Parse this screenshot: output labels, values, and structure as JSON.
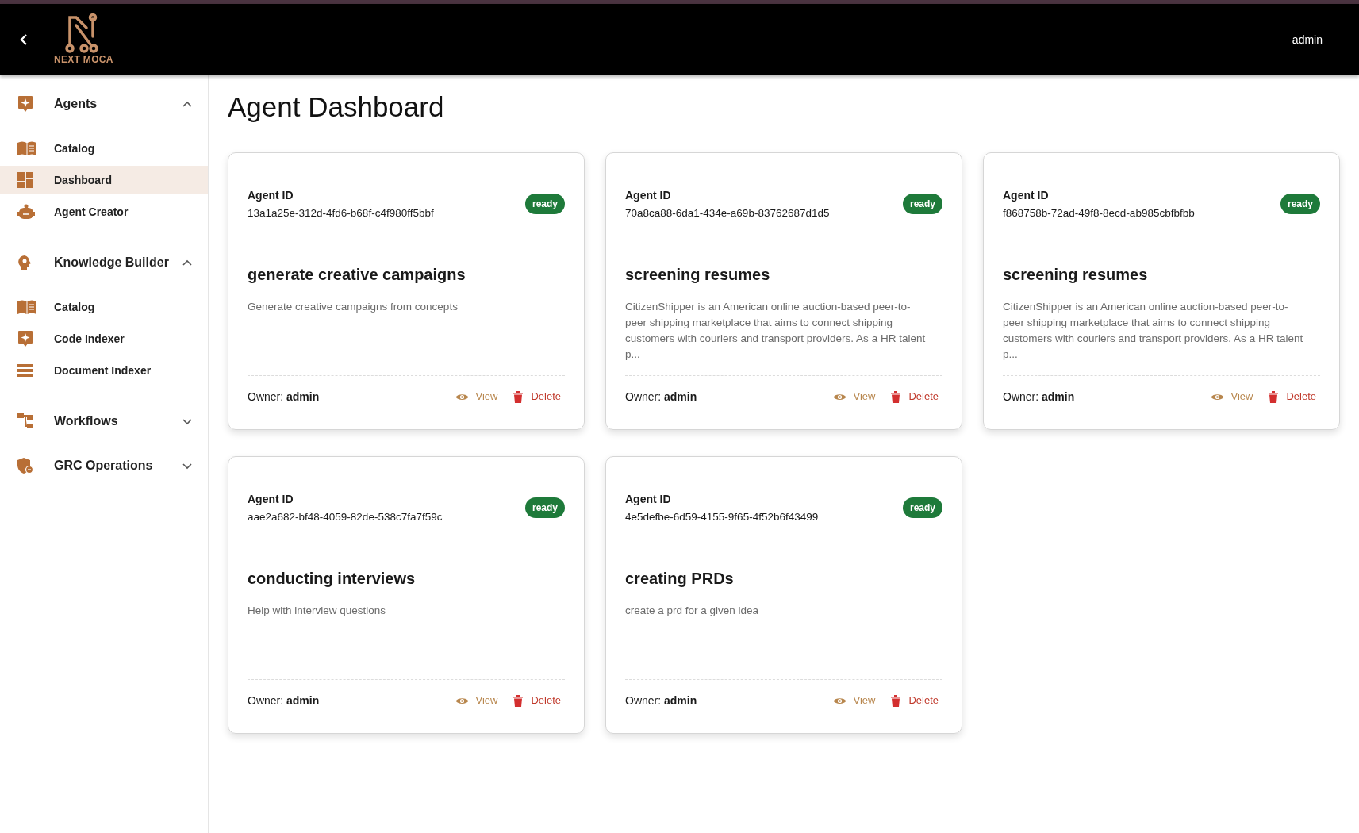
{
  "header": {
    "logo_text": "NEXT MOCA",
    "user": "admin"
  },
  "sidebar": {
    "sections": [
      {
        "label": "Agents",
        "expanded": true,
        "children": [
          {
            "label": "Catalog",
            "selected": false
          },
          {
            "label": "Dashboard",
            "selected": true
          },
          {
            "label": "Agent Creator",
            "selected": false
          }
        ]
      },
      {
        "label": "Knowledge Builder",
        "expanded": true,
        "children": [
          {
            "label": "Catalog",
            "selected": false
          },
          {
            "label": "Code Indexer",
            "selected": false
          },
          {
            "label": "Document Indexer",
            "selected": false
          }
        ]
      },
      {
        "label": "Workflows",
        "expanded": false
      },
      {
        "label": "GRC Operations",
        "expanded": false
      }
    ]
  },
  "page_title": "Agent Dashboard",
  "cards": [
    {
      "id_label": "Agent ID",
      "id": "13a1a25e-312d-4fd6-b68f-c4f980ff5bbf",
      "status": "ready",
      "title": "generate creative campaigns",
      "description": "Generate creative campaigns from concepts",
      "owner": "Owner: **admin**",
      "view": "View",
      "delete": "Delete"
    },
    {
      "id_label": "Agent ID",
      "id": "70a8ca88-6da1-434e-a69b-83762687d1d5",
      "status": "ready",
      "title": "screening resumes",
      "description": "CitizenShipper is an American online auction-based peer-to-peer shipping marketplace that aims to connect shipping customers with couriers and transport providers. As a HR talent p...",
      "owner": "Owner: **admin**",
      "view": "View",
      "delete": "Delete"
    },
    {
      "id_label": "Agent ID",
      "id": "f868758b-72ad-49f8-8ecd-ab985cbfbfbb",
      "status": "ready",
      "title": "screening resumes",
      "description": "CitizenShipper is an American online auction-based peer-to-peer shipping marketplace that aims to connect shipping customers with couriers and transport providers. As a HR talent p...",
      "owner": "Owner: **admin**",
      "view": "View",
      "delete": "Delete"
    },
    {
      "id_label": "Agent ID",
      "id": "aae2a682-bf48-4059-82de-538c7fa7f59c",
      "status": "ready",
      "title": "conducting interviews",
      "description": "Help with interview questions",
      "owner": "Owner: **admin**",
      "view": "View",
      "delete": "Delete"
    },
    {
      "id_label": "Agent ID",
      "id": "4e5defbe-6d59-4155-9f65-4f52b6f43499",
      "status": "ready",
      "title": "creating PRDs",
      "description": "create a prd for a given idea",
      "owner": "Owner: **admin**",
      "view": "View",
      "delete": "Delete"
    }
  ]
}
